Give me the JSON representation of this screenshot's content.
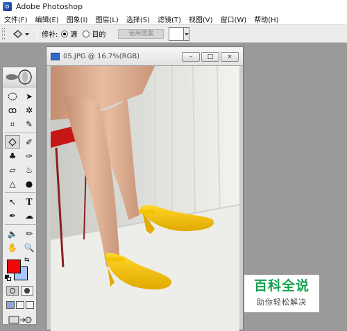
{
  "app": {
    "title": "Adobe Photoshop"
  },
  "menu": [
    "文件(F)",
    "编辑(E)",
    "图象(I)",
    "图层(L)",
    "选择(S)",
    "滤镜(T)",
    "视图(V)",
    "窗口(W)",
    "帮助(H)"
  ],
  "options": {
    "patch_label": "修补:",
    "source_label": "源",
    "destination_label": "目的",
    "selected": "源",
    "use_pattern_label": "使用图案"
  },
  "document": {
    "title": "05.JPG @ 16.7%(RGB)",
    "minimize": "–",
    "maximize": "□",
    "close": "×"
  },
  "colors": {
    "foreground": "#f00808",
    "background": "#a6c8ff"
  },
  "watermark": {
    "main": "百科全说",
    "sub": "助你轻松解决"
  }
}
